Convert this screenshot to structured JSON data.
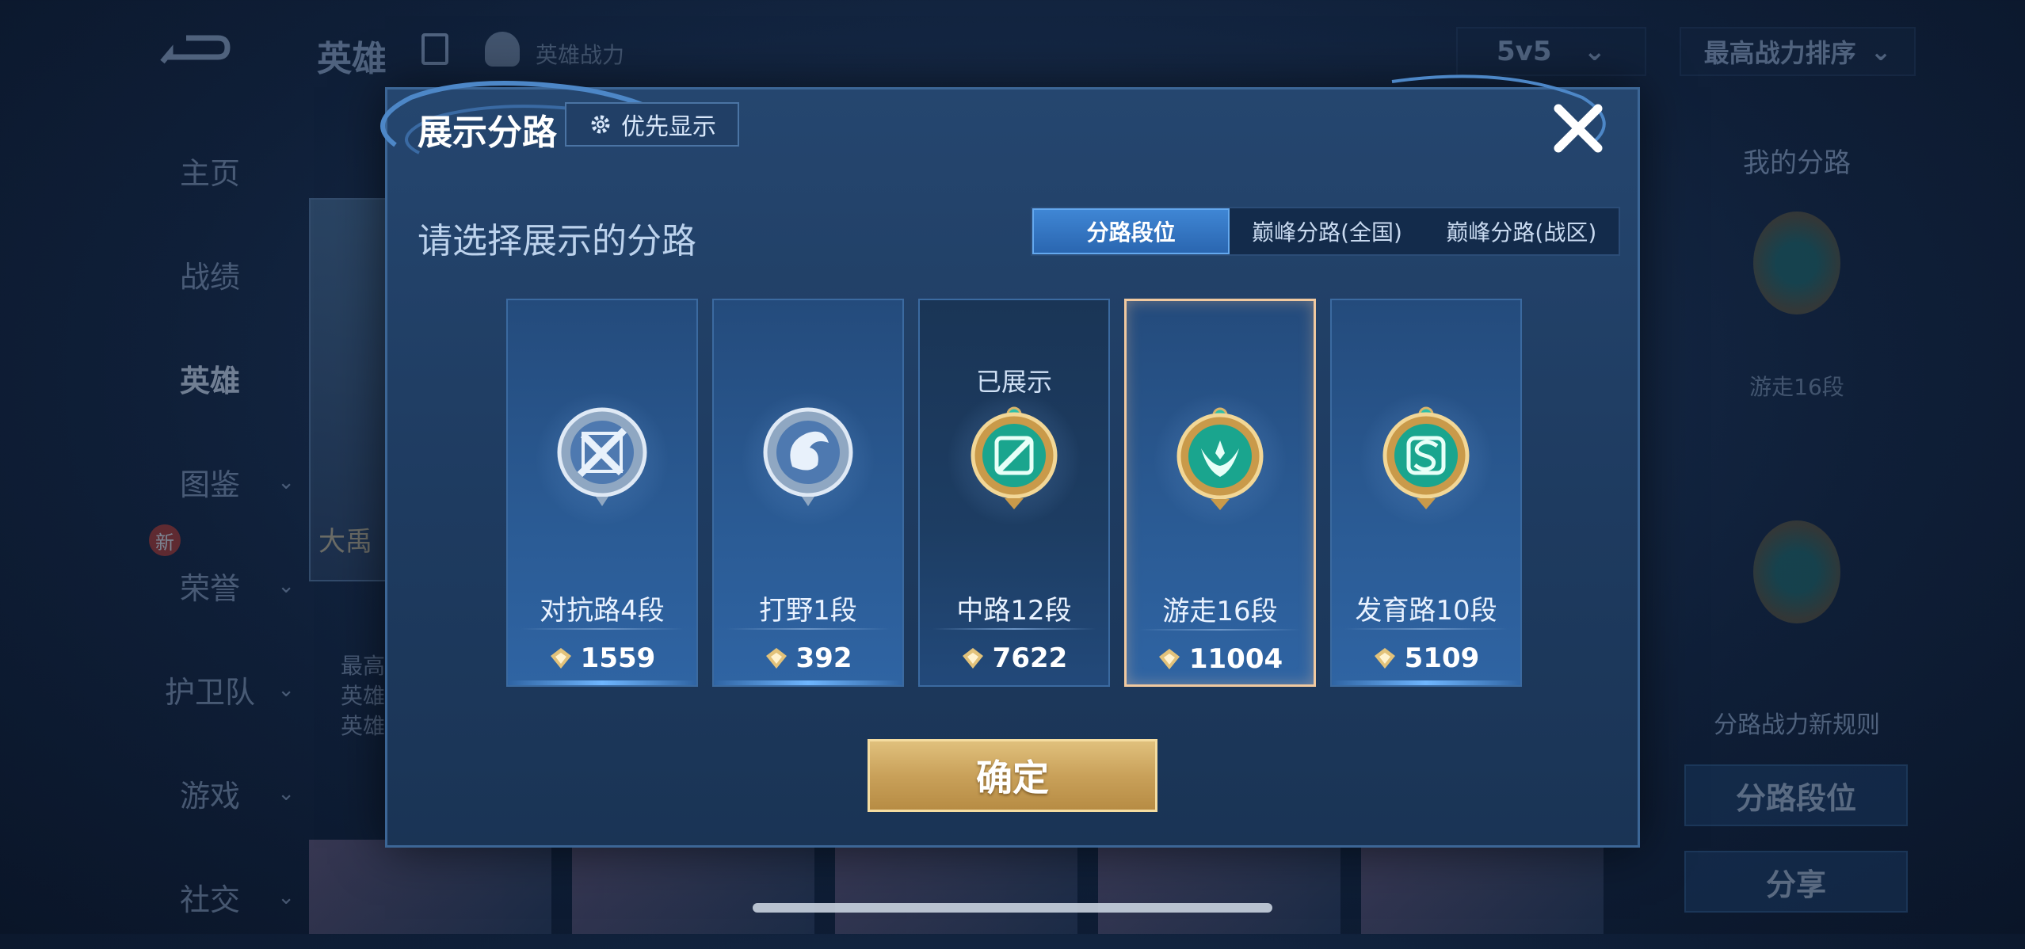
{
  "background": {
    "top_title": "英雄",
    "top_subtitle": "英雄战力",
    "mode_select": "5v5",
    "sort_select": "最高战力排序",
    "nav": [
      {
        "label": "主页",
        "chevron": false
      },
      {
        "label": "战绩",
        "chevron": false
      },
      {
        "label": "英雄",
        "chevron": false,
        "active": true
      },
      {
        "label": "图鉴",
        "chevron": true
      },
      {
        "label": "荣誉",
        "chevron": true
      },
      {
        "label": "护卫队",
        "chevron": true
      },
      {
        "label": "游戏",
        "chevron": true
      },
      {
        "label": "社交",
        "chevron": true
      }
    ],
    "nav_new_badge": "新",
    "hero_name": "大禹",
    "hero_info": [
      "最高",
      "英雄",
      "英雄"
    ],
    "right_panel": {
      "title": "我的分路",
      "lane_label": "游走16段",
      "rule_link": "分路战力新规则",
      "lane_rank_button": "分路段位",
      "share_button": "分享"
    }
  },
  "modal": {
    "title": "展示分路",
    "priority_button": "优先显示",
    "subtitle": "请选择展示的分路",
    "tabs": [
      {
        "label": "分路段位",
        "active": true
      },
      {
        "label": "巅峰分路(全国)",
        "active": false
      },
      {
        "label": "巅峰分路(战区)",
        "active": false
      }
    ],
    "lanes": [
      {
        "name": "对抗路4段",
        "power": "1559",
        "shown_label": "",
        "selected": false,
        "badge": "silver-sword-badge"
      },
      {
        "name": "打野1段",
        "power": "392",
        "shown_label": "",
        "selected": false,
        "badge": "silver-dragon-badge"
      },
      {
        "name": "中路12段",
        "power": "7622",
        "shown_label": "已展示",
        "selected": false,
        "badge": "gold-mid-badge"
      },
      {
        "name": "游走16段",
        "power": "11004",
        "shown_label": "",
        "selected": true,
        "badge": "gold-support-badge"
      },
      {
        "name": "发育路10段",
        "power": "5109",
        "shown_label": "",
        "selected": false,
        "badge": "gold-adc-badge"
      }
    ],
    "confirm_button": "确定"
  },
  "colors": {
    "accent_gold": "#c9a15a",
    "tab_active": "#3f86d4",
    "selected_border": "#f0c9a0"
  }
}
